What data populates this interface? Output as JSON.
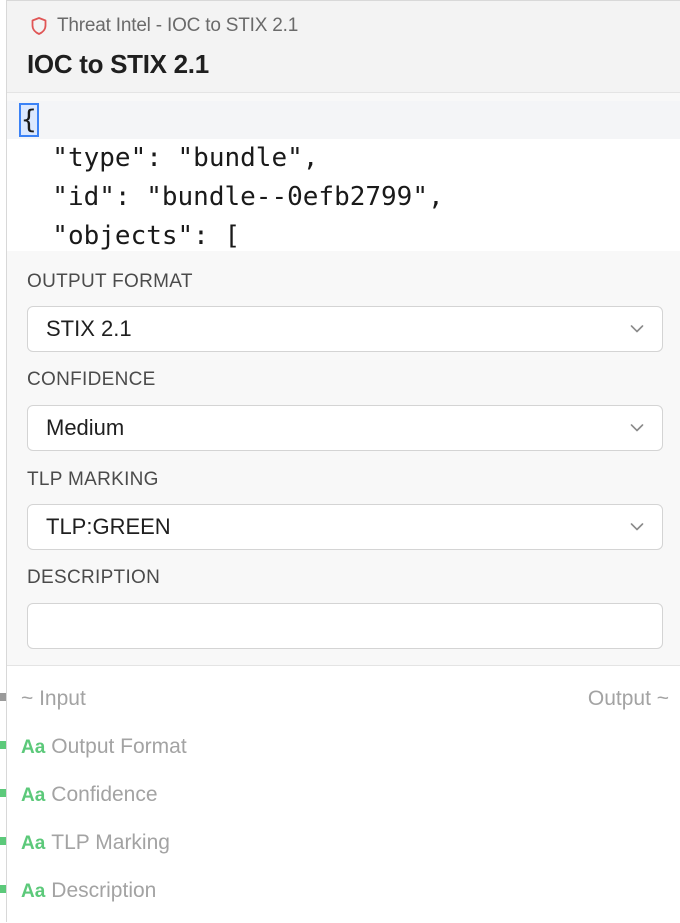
{
  "header": {
    "subtitle": "Threat Intel - IOC to STIX 2.1",
    "title": "IOC to STIX 2.1",
    "icon": "shield-icon",
    "accent": "#e05555"
  },
  "code_preview": {
    "lines": [
      "{",
      "  \"type\": \"bundle\",",
      "  \"id\": \"bundle--0efb2799\",",
      "  \"objects\": ["
    ]
  },
  "fields": {
    "output_format": {
      "label": "OUTPUT FORMAT",
      "value": "STIX 2.1"
    },
    "confidence": {
      "label": "CONFIDENCE",
      "value": "Medium"
    },
    "tlp_marking": {
      "label": "TLP MARKING",
      "value": "TLP:GREEN"
    },
    "description": {
      "label": "DESCRIPTION",
      "value": "",
      "placeholder": ""
    }
  },
  "io": {
    "input_label": "~ Input",
    "output_label": "Output ~",
    "type_badge": "Aa",
    "inputs": [
      "Output Format",
      "Confidence",
      "TLP Marking",
      "Description"
    ]
  },
  "colors": {
    "string_port": "#5cc97a",
    "generic_port": "#9a9a9a",
    "selection": "#3b82f6"
  }
}
